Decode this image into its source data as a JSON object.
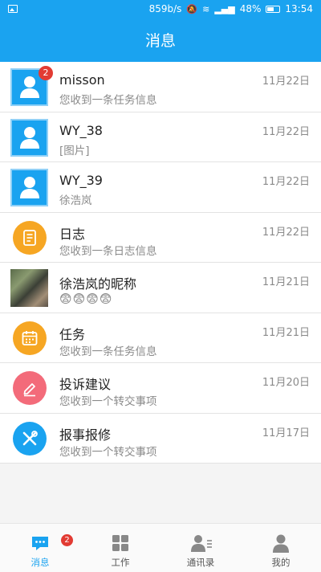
{
  "status_bar": {
    "speed": "859b/s",
    "battery": "48%",
    "time": "13:54"
  },
  "header": {
    "title": "消息"
  },
  "messages": [
    {
      "name": "misson",
      "preview": "您收到一条任务信息",
      "date": "11月22日",
      "badge": "2"
    },
    {
      "name": "WY_38",
      "preview": "[图片]",
      "date": "11月22日"
    },
    {
      "name": "WY_39",
      "preview": "徐浩岚",
      "date": "11月22日"
    },
    {
      "name": "日志",
      "preview": "您收到一条日志信息",
      "date": "11月22日"
    },
    {
      "name": "徐浩岚的昵称",
      "preview": "😨😨😨😨",
      "date": "11月21日"
    },
    {
      "name": "任务",
      "preview": "您收到一条任务信息",
      "date": "11月21日"
    },
    {
      "name": "投诉建议",
      "preview": "您收到一个转交事项",
      "date": "11月20日"
    },
    {
      "name": "报事报修",
      "preview": "您收到一个转交事项",
      "date": "11月17日"
    }
  ],
  "tabs": [
    {
      "label": "消息",
      "badge": "2",
      "active": true
    },
    {
      "label": "工作"
    },
    {
      "label": "通讯录"
    },
    {
      "label": "我的"
    }
  ],
  "colors": {
    "accent": "#1aa3f0",
    "badge": "#e23b33",
    "orange": "#f6a623",
    "pink": "#f36b7a"
  }
}
